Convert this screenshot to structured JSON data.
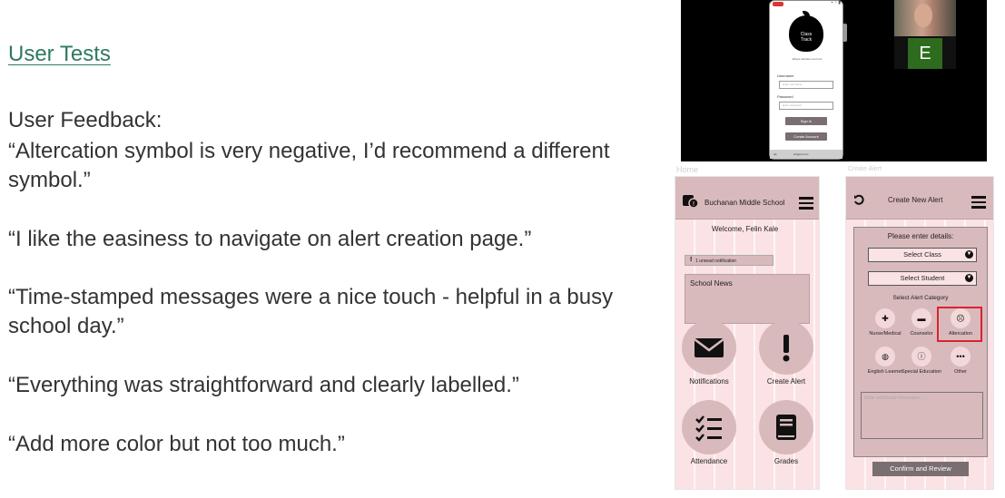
{
  "slide": {
    "heading": "User Tests",
    "feedback_label": "User Feedback:",
    "quotes": [
      "“Altercation symbol is very negative, I’d recommend a different symbol.”",
      "“I like the easiness to navigate on alert creation page.”",
      "“Time-stamped messages were a nice touch - helpful in a busy school day.”",
      "“Everything was straightforward and clearly labelled.”",
      "“Add more color but not too much.”"
    ],
    "text_color": "#333333",
    "heading_color": "#2e7a5e"
  },
  "video_call": {
    "app_name_line1": "Class",
    "app_name_line2": "Track",
    "tagline": "Where teachers and mor",
    "username_label": "Username",
    "username_placeholder": "Enter username",
    "password_label": "Password",
    "password_placeholder": "Enter password",
    "sign_in": "Sign In",
    "create_account": "Create Account",
    "bottom_left": "aA",
    "bottom_center": "â figma.com",
    "participant_initial": "E",
    "participant_color": "#2e6b1e"
  },
  "home_screen": {
    "caption": "Home",
    "school_name": "Buchanan Middle School",
    "welcome": "Welcome, Felin Kale",
    "notification_icon": "!",
    "unread_text": "1 unread notification",
    "news_title": "School News",
    "tiles": [
      {
        "label": "Notifications",
        "icon": "envelope-icon"
      },
      {
        "label": "Create Alert",
        "icon": "exclamation-icon"
      },
      {
        "label": "Attendance",
        "icon": "checklist-icon"
      },
      {
        "label": "Grades",
        "icon": "book-icon"
      }
    ],
    "bg_color": "#fbe2e4",
    "accent_color": "#d9babc"
  },
  "alert_screen": {
    "caption": "Create Alert",
    "title": "Create New Alert",
    "details_prompt": "Please enter details:",
    "select_class": "Select Class",
    "select_student": "Select Student",
    "category_prompt": "Select Alert Category",
    "categories": [
      {
        "label": "Nurse/Medical",
        "icon": "medkit-icon"
      },
      {
        "label": "Counselor",
        "icon": "chat-icon"
      },
      {
        "label": "Altercation",
        "icon": "sad-face-icon"
      },
      {
        "label": "English Learner",
        "icon": "globe-icon"
      },
      {
        "label": "Special Education",
        "icon": "info-icon"
      },
      {
        "label": "Other",
        "icon": "ellipsis-icon"
      }
    ],
    "additional_info_placeholder": "Enter additional information...",
    "confirm_button": "Confirm and Review",
    "highlight_color": "#d9232e"
  }
}
